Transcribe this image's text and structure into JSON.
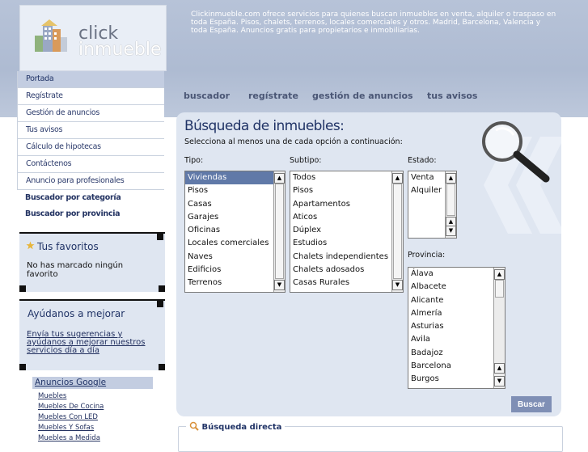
{
  "header": {
    "logo_line1": "click",
    "logo_line2": "inmueble",
    "description": "Clickinmueble.com ofrece servicios para quienes buscan inmuebles en venta, alquiler o traspaso en toda España. Pisos, chalets, terrenos, locales comerciales y otros. Madrid, Barcelona, Valencia y toda España. Anuncios gratis para propietarios e inmobiliarias."
  },
  "sidebar": {
    "items": [
      {
        "label": "Portada"
      },
      {
        "label": "Regístrate"
      },
      {
        "label": "Gestión de anuncios"
      },
      {
        "label": "Tus avisos"
      },
      {
        "label": "Cálculo de hipotecas"
      },
      {
        "label": "Contáctenos"
      },
      {
        "label": "Anuncio para profesionales"
      },
      {
        "label": "Buscador por categoría"
      },
      {
        "label": "Buscador por provincia"
      }
    ],
    "favorites": {
      "title": "Tus favoritos",
      "text": "No has marcado ningún favorito"
    },
    "help": {
      "title": "Ayúdanos a mejorar",
      "link": "Envía tus sugerencias y ayúdanos a mejorar nuestros servicios día a día"
    },
    "ads": {
      "title": "Anuncios Google",
      "links": [
        "Muebles",
        "Muebles De Cocina",
        "Muebles Con LED",
        "Muebles Y Sofas",
        "Muebles a Medida"
      ]
    }
  },
  "tabs": [
    "buscador",
    "regístrate",
    "gestión de anuncios",
    "tus avisos"
  ],
  "search": {
    "title": "Búsqueda de inmuebles:",
    "subtitle": "Selecciona al menos una de cada opción a continuación:",
    "tipo": {
      "label": "Tipo:",
      "selected": "Viviendas",
      "options": [
        "Viviendas",
        "Pisos",
        "Casas",
        "Garajes",
        "Oficinas",
        "Locales comerciales",
        "Naves",
        "Edificios",
        "Terrenos"
      ]
    },
    "subtipo": {
      "label": "Subtipo:",
      "options": [
        "Todos",
        "Pisos",
        "Apartamentos",
        "Aticos",
        "Dúplex",
        "Estudios",
        "Chalets independientes",
        "Chalets adosados",
        "Casas Rurales"
      ]
    },
    "estado": {
      "label": "Estado:",
      "options": [
        "Venta",
        "Alquiler"
      ]
    },
    "provincia": {
      "label": "Provincia:",
      "options": [
        "Álava",
        "Albacete",
        "Alicante",
        "Almería",
        "Asturias",
        "Avila",
        "Badajoz",
        "Barcelona",
        "Burgos"
      ]
    },
    "button": "Buscar",
    "direct_legend": "Búsqueda directa"
  },
  "icons": {
    "scroll_up": "triangle-up-icon",
    "scroll_down": "triangle-down-icon",
    "favorite": "star-icon",
    "magnifier": "magnifier-icon"
  },
  "colors": {
    "accent": "#203366",
    "panel": "#dfe6f1",
    "header": "#aebbd2",
    "selected": "#6079a8",
    "button": "#7f8fb5"
  }
}
